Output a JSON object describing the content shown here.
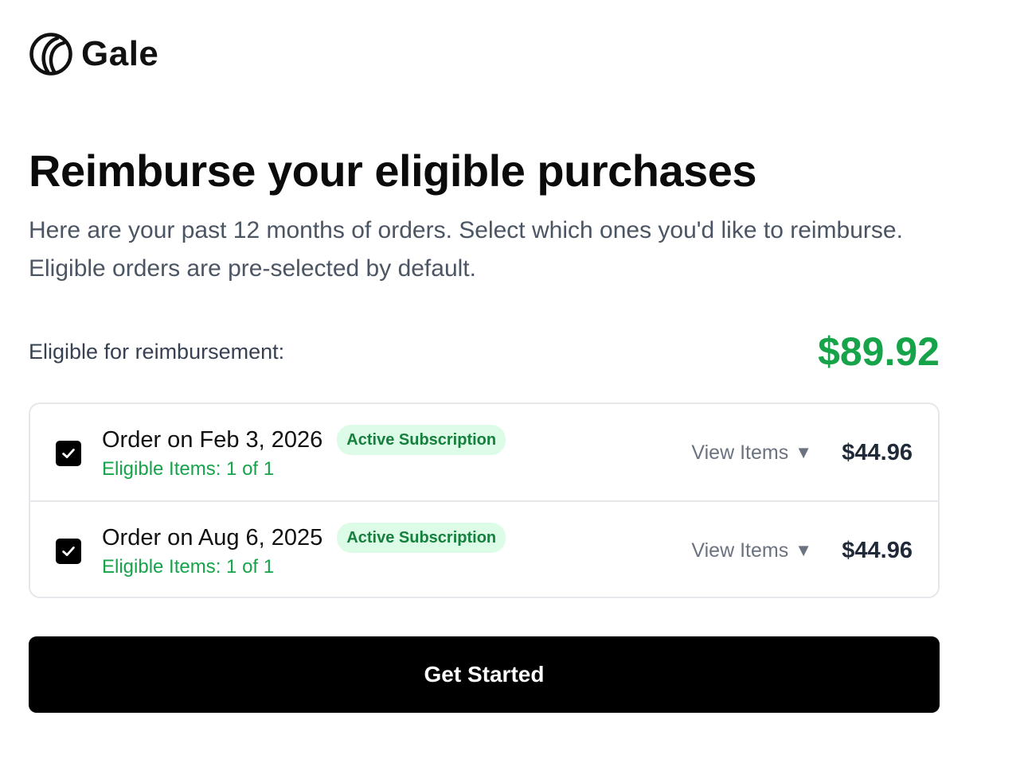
{
  "brand": {
    "name": "Gale",
    "logo_icon": "gale-logo-icon"
  },
  "header": {
    "title": "Reimburse your eligible purchases",
    "subtitle": "Here are your past 12 months of orders. Select which ones you'd like to reimburse. Eligible orders are pre-selected by default."
  },
  "summary": {
    "label": "Eligible for reimbursement:",
    "amount": "$89.92",
    "amount_color": "#16a34a"
  },
  "orders": [
    {
      "checked": true,
      "title": "Order on Feb 3, 2026",
      "badge": "Active Subscription",
      "eligible": "Eligible Items: 1 of 1",
      "view_label": "View Items",
      "caret": "▼",
      "price": "$44.96"
    },
    {
      "checked": true,
      "title": "Order on Aug 6, 2025",
      "badge": "Active Subscription",
      "eligible": "Eligible Items: 1 of 1",
      "view_label": "View Items",
      "caret": "▼",
      "price": "$44.96"
    }
  ],
  "cta": {
    "label": "Get Started"
  },
  "colors": {
    "accent_green": "#16a34a",
    "badge_bg": "#dcfce7",
    "badge_text": "#15803d",
    "primary_button": "#000000"
  }
}
